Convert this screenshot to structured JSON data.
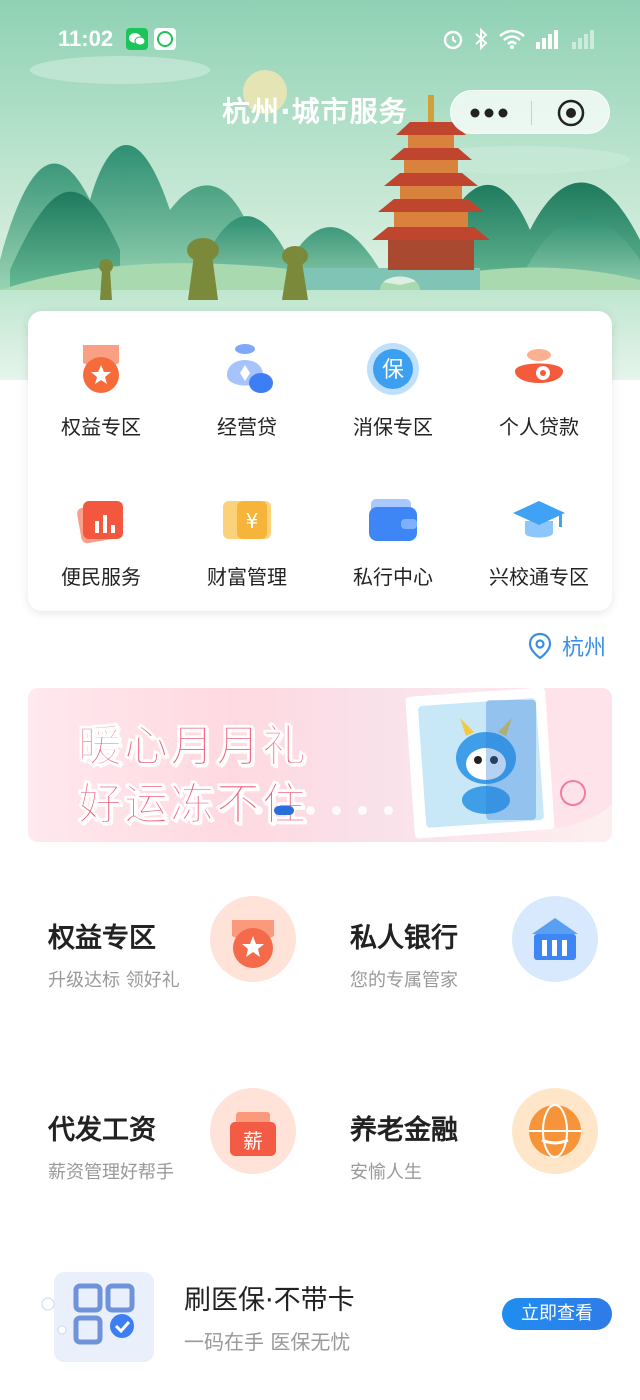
{
  "status_bar": {
    "time": "11:02",
    "icons": [
      "wechat-icon",
      "app-icon",
      "alarm-icon",
      "bluetooth-icon",
      "wifi-icon",
      "signal-4g-icon",
      "signal-icon"
    ]
  },
  "nav": {
    "title": "杭州·城市服务",
    "more_icon": "more-icon",
    "close_icon": "record-icon"
  },
  "grid": {
    "items": [
      {
        "label": "权益专区",
        "icon": "medal-icon",
        "color": "#f76a3a"
      },
      {
        "label": "经营贷",
        "icon": "money-bag-icon",
        "color": "#4f86f7"
      },
      {
        "label": "消保专区",
        "icon": "shield-icon",
        "color": "#3d9ff0",
        "icon_text": "保"
      },
      {
        "label": "个人贷款",
        "icon": "coin-pouch-icon",
        "color": "#f55a3a"
      },
      {
        "label": "便民服务",
        "icon": "chart-card-icon",
        "color": "#f3573d"
      },
      {
        "label": "财富管理",
        "icon": "wealth-icon",
        "color": "#f7b43a",
        "icon_text": "¥"
      },
      {
        "label": "私行中心",
        "icon": "wallet-icon",
        "color": "#3e86f5"
      },
      {
        "label": "兴校通专区",
        "icon": "graduation-cap-icon",
        "color": "#3fa2f5"
      }
    ]
  },
  "location": {
    "city": "杭州",
    "icon": "location-pin-icon"
  },
  "banner": {
    "line1": "暖心月月礼",
    "line2": "好运冻不住",
    "active_index": 1,
    "dot_count": 6
  },
  "features": [
    {
      "title": "权益专区",
      "subtitle": "升级达标 领好礼",
      "icon": "medal-icon"
    },
    {
      "title": "私人银行",
      "subtitle": "您的专属管家",
      "icon": "bank-icon"
    },
    {
      "title": "代发工资",
      "subtitle": "薪资管理好帮手",
      "icon": "salary-icon",
      "icon_text": "薪"
    },
    {
      "title": "养老金融",
      "subtitle": "安愉人生",
      "icon": "globe-icon"
    }
  ],
  "medical": {
    "title": "刷医保·不带卡",
    "subtitle": "一码在手 医保无忧",
    "button": "立即查看",
    "icon": "qr-code-icon"
  }
}
